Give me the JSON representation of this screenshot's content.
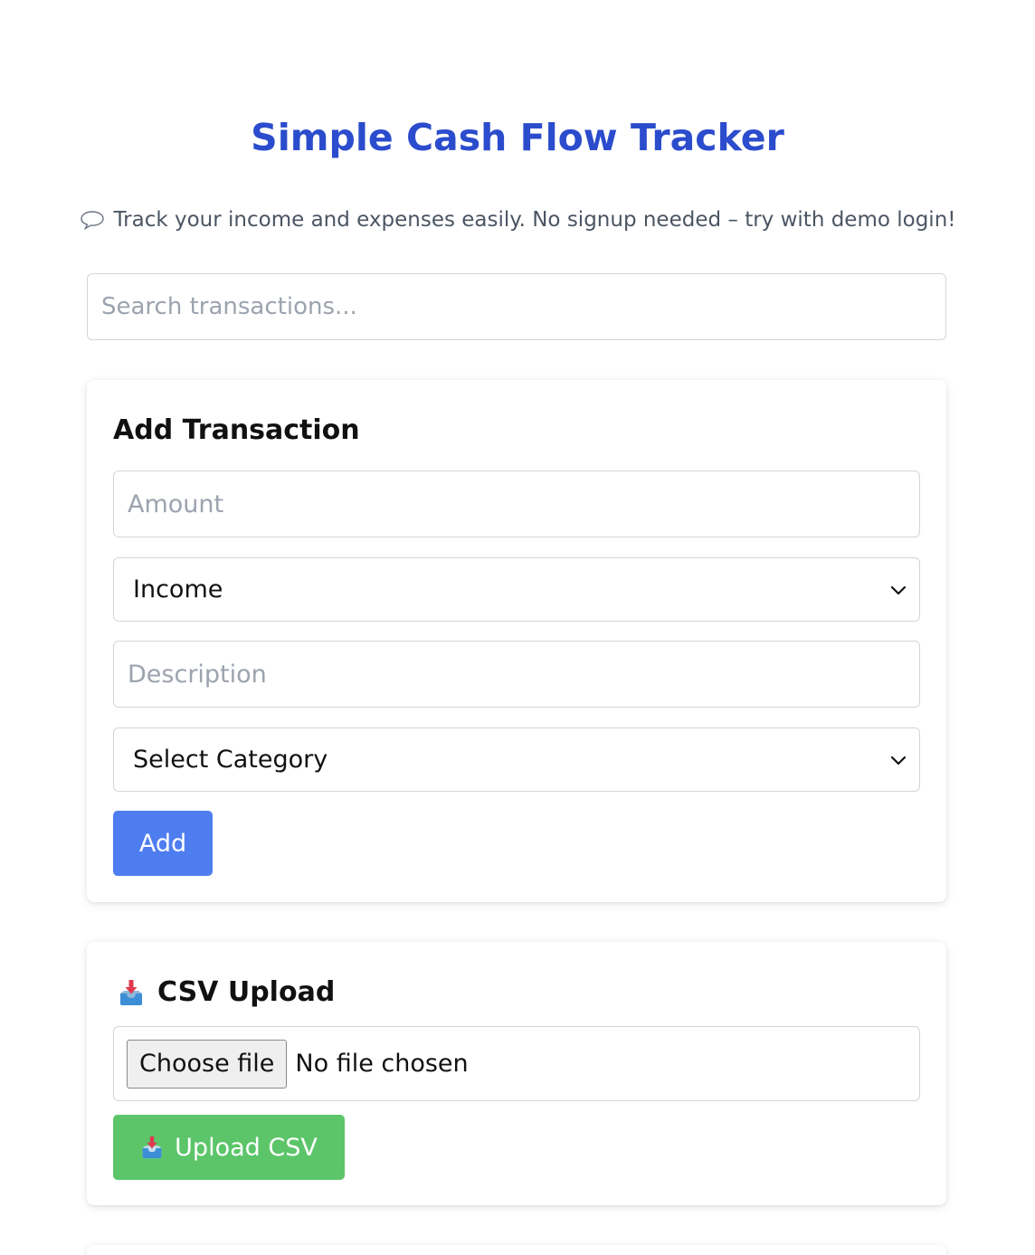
{
  "header": {
    "title": "Simple Cash Flow Tracker",
    "subtitle_icon": "speech-bubble-icon",
    "subtitle": "Track your income and expenses easily. No signup needed – try with demo login!"
  },
  "search": {
    "placeholder": "Search transactions..."
  },
  "add_transaction": {
    "title": "Add Transaction",
    "amount_placeholder": "Amount",
    "type_selected": "Income",
    "description_placeholder": "Description",
    "category_selected": "Select Category",
    "add_label": "Add",
    "add_color": "#4e7df0"
  },
  "csv_upload": {
    "title_icon": "inbox-download-icon",
    "title": "CSV Upload",
    "choose_file_label": "Choose file",
    "file_status": "No file chosen",
    "upload_label": "Upload CSV",
    "upload_color": "#5cc56a"
  },
  "colors": {
    "title": "#2b4ccc"
  }
}
